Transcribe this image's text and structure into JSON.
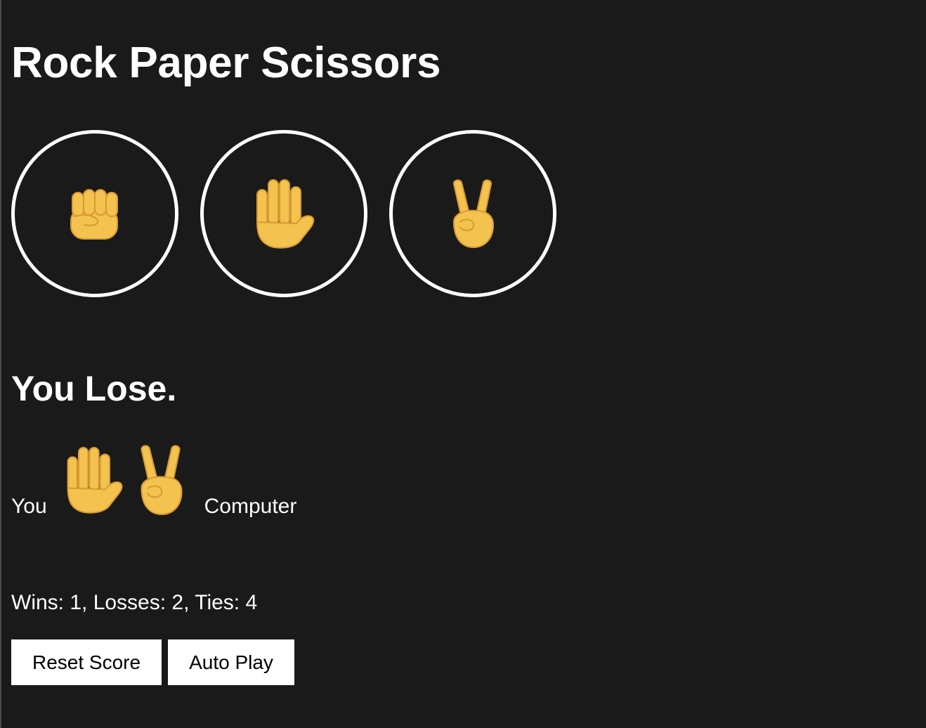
{
  "title": "Rock Paper Scissors",
  "choices": [
    {
      "name": "rock",
      "icon": "fist-emoji-icon"
    },
    {
      "name": "paper",
      "icon": "raised-hand-emoji-icon"
    },
    {
      "name": "scissors",
      "icon": "victory-hand-emoji-icon"
    }
  ],
  "result": "You Lose.",
  "moves": {
    "you_label": "You",
    "player_move": "paper",
    "computer_move": "scissors",
    "computer_label": "Computer"
  },
  "score": {
    "text": "Wins: 1, Losses: 2, Ties: 4",
    "wins": 1,
    "losses": 2,
    "ties": 4
  },
  "buttons": {
    "reset_label": "Reset Score",
    "auto_play_label": "Auto Play"
  },
  "colors": {
    "background": "#1a1a1a",
    "text": "#ffffff",
    "button_background": "#ffffff",
    "button_text": "#000000",
    "emoji_skin": "#f3c24f"
  }
}
